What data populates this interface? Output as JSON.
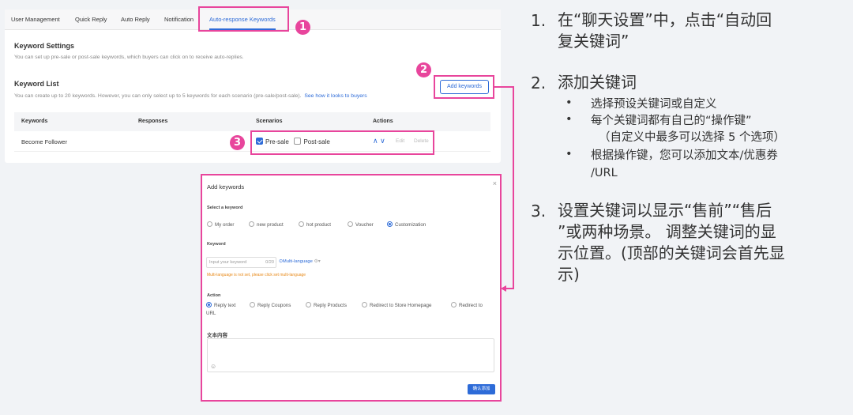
{
  "tabs": [
    "User Management",
    "Quick Reply",
    "Auto Reply",
    "Notification",
    "Auto-response Keywords"
  ],
  "steps": [
    "1",
    "2",
    "3"
  ],
  "keyword_settings": {
    "title": "Keyword Settings",
    "desc": "You can set up pre-sale or post-sale keywords, which buyers can click on to receive auto-replies."
  },
  "keyword_list": {
    "title": "Keyword List",
    "desc": "You can create up to 20 keywords. However, you can only select up to 5 keywords for each scenario (pre-sale/post-sale).",
    "link": "See how it looks to buyers",
    "add_button": "Add keywords"
  },
  "table": {
    "headers": [
      "Keywords",
      "Responses",
      "Scenarios",
      "Actions"
    ],
    "row": {
      "keyword": "Become Follower",
      "presale": "Pre-sale",
      "postsale": "Post-sale",
      "edit": "Edit",
      "delete": "Delete"
    }
  },
  "modal": {
    "title": "Add keywords",
    "select_label": "Select a keyword",
    "keyword_options": [
      "My order",
      "new product",
      "hot product",
      "Voucher",
      "Customization"
    ],
    "keyword_label": "Keyword",
    "input_placeholder": "Input your keyword",
    "counter": "0/20",
    "multi_language": "Multi-language",
    "warning": "Multi-language is not set, please click set multi-language",
    "action_label": "Action",
    "action_options": [
      "Reply text",
      "Reply Coupons",
      "Reply Products",
      "Redirect to Store Homepage",
      "Redirect to"
    ],
    "action_wrap": "URL",
    "content_label": "文本内容",
    "confirm": "确认添加"
  },
  "instructions": {
    "s1_num": "1.",
    "s1_l1": "在“聊天设置”中，点击“自动回",
    "s1_l2": "复关键词”",
    "s2_num": "2.",
    "s2_title": "添加关键词",
    "s2_b1": "选择预设关键词或自定义",
    "s2_b2": "每个关键词都有自己的“操作键”",
    "s2_b2b": "（自定义中最多可以选择 5 个选项）",
    "s2_b3": "根据操作键，您可以添加文本/优惠券",
    "s2_b3b": "/URL",
    "s3_num": "3.",
    "s3_l1": "设置关键词以显示“售前”“售后",
    "s3_l2": "”或两种场景。 调整关键词的显",
    "s3_l3": "示位置。(顶部的关键词会首先显",
    "s3_l4": "示)"
  },
  "colors": {
    "accent": "#e8459c",
    "link": "#2d6bd8"
  }
}
